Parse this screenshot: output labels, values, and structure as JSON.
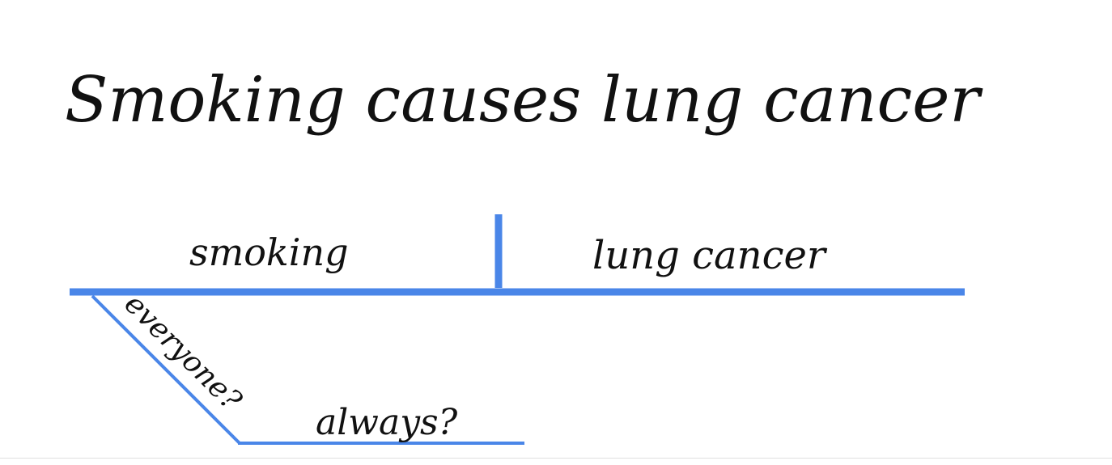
{
  "title": "Smoking causes lung cancer",
  "diagram": {
    "subject": "smoking",
    "predicate": "lung cancer",
    "modifier_1": "everyone?",
    "modifier_2": "always?"
  },
  "colors": {
    "line": "#4A86E8",
    "ink": "#111111",
    "background": "#ffffff"
  }
}
